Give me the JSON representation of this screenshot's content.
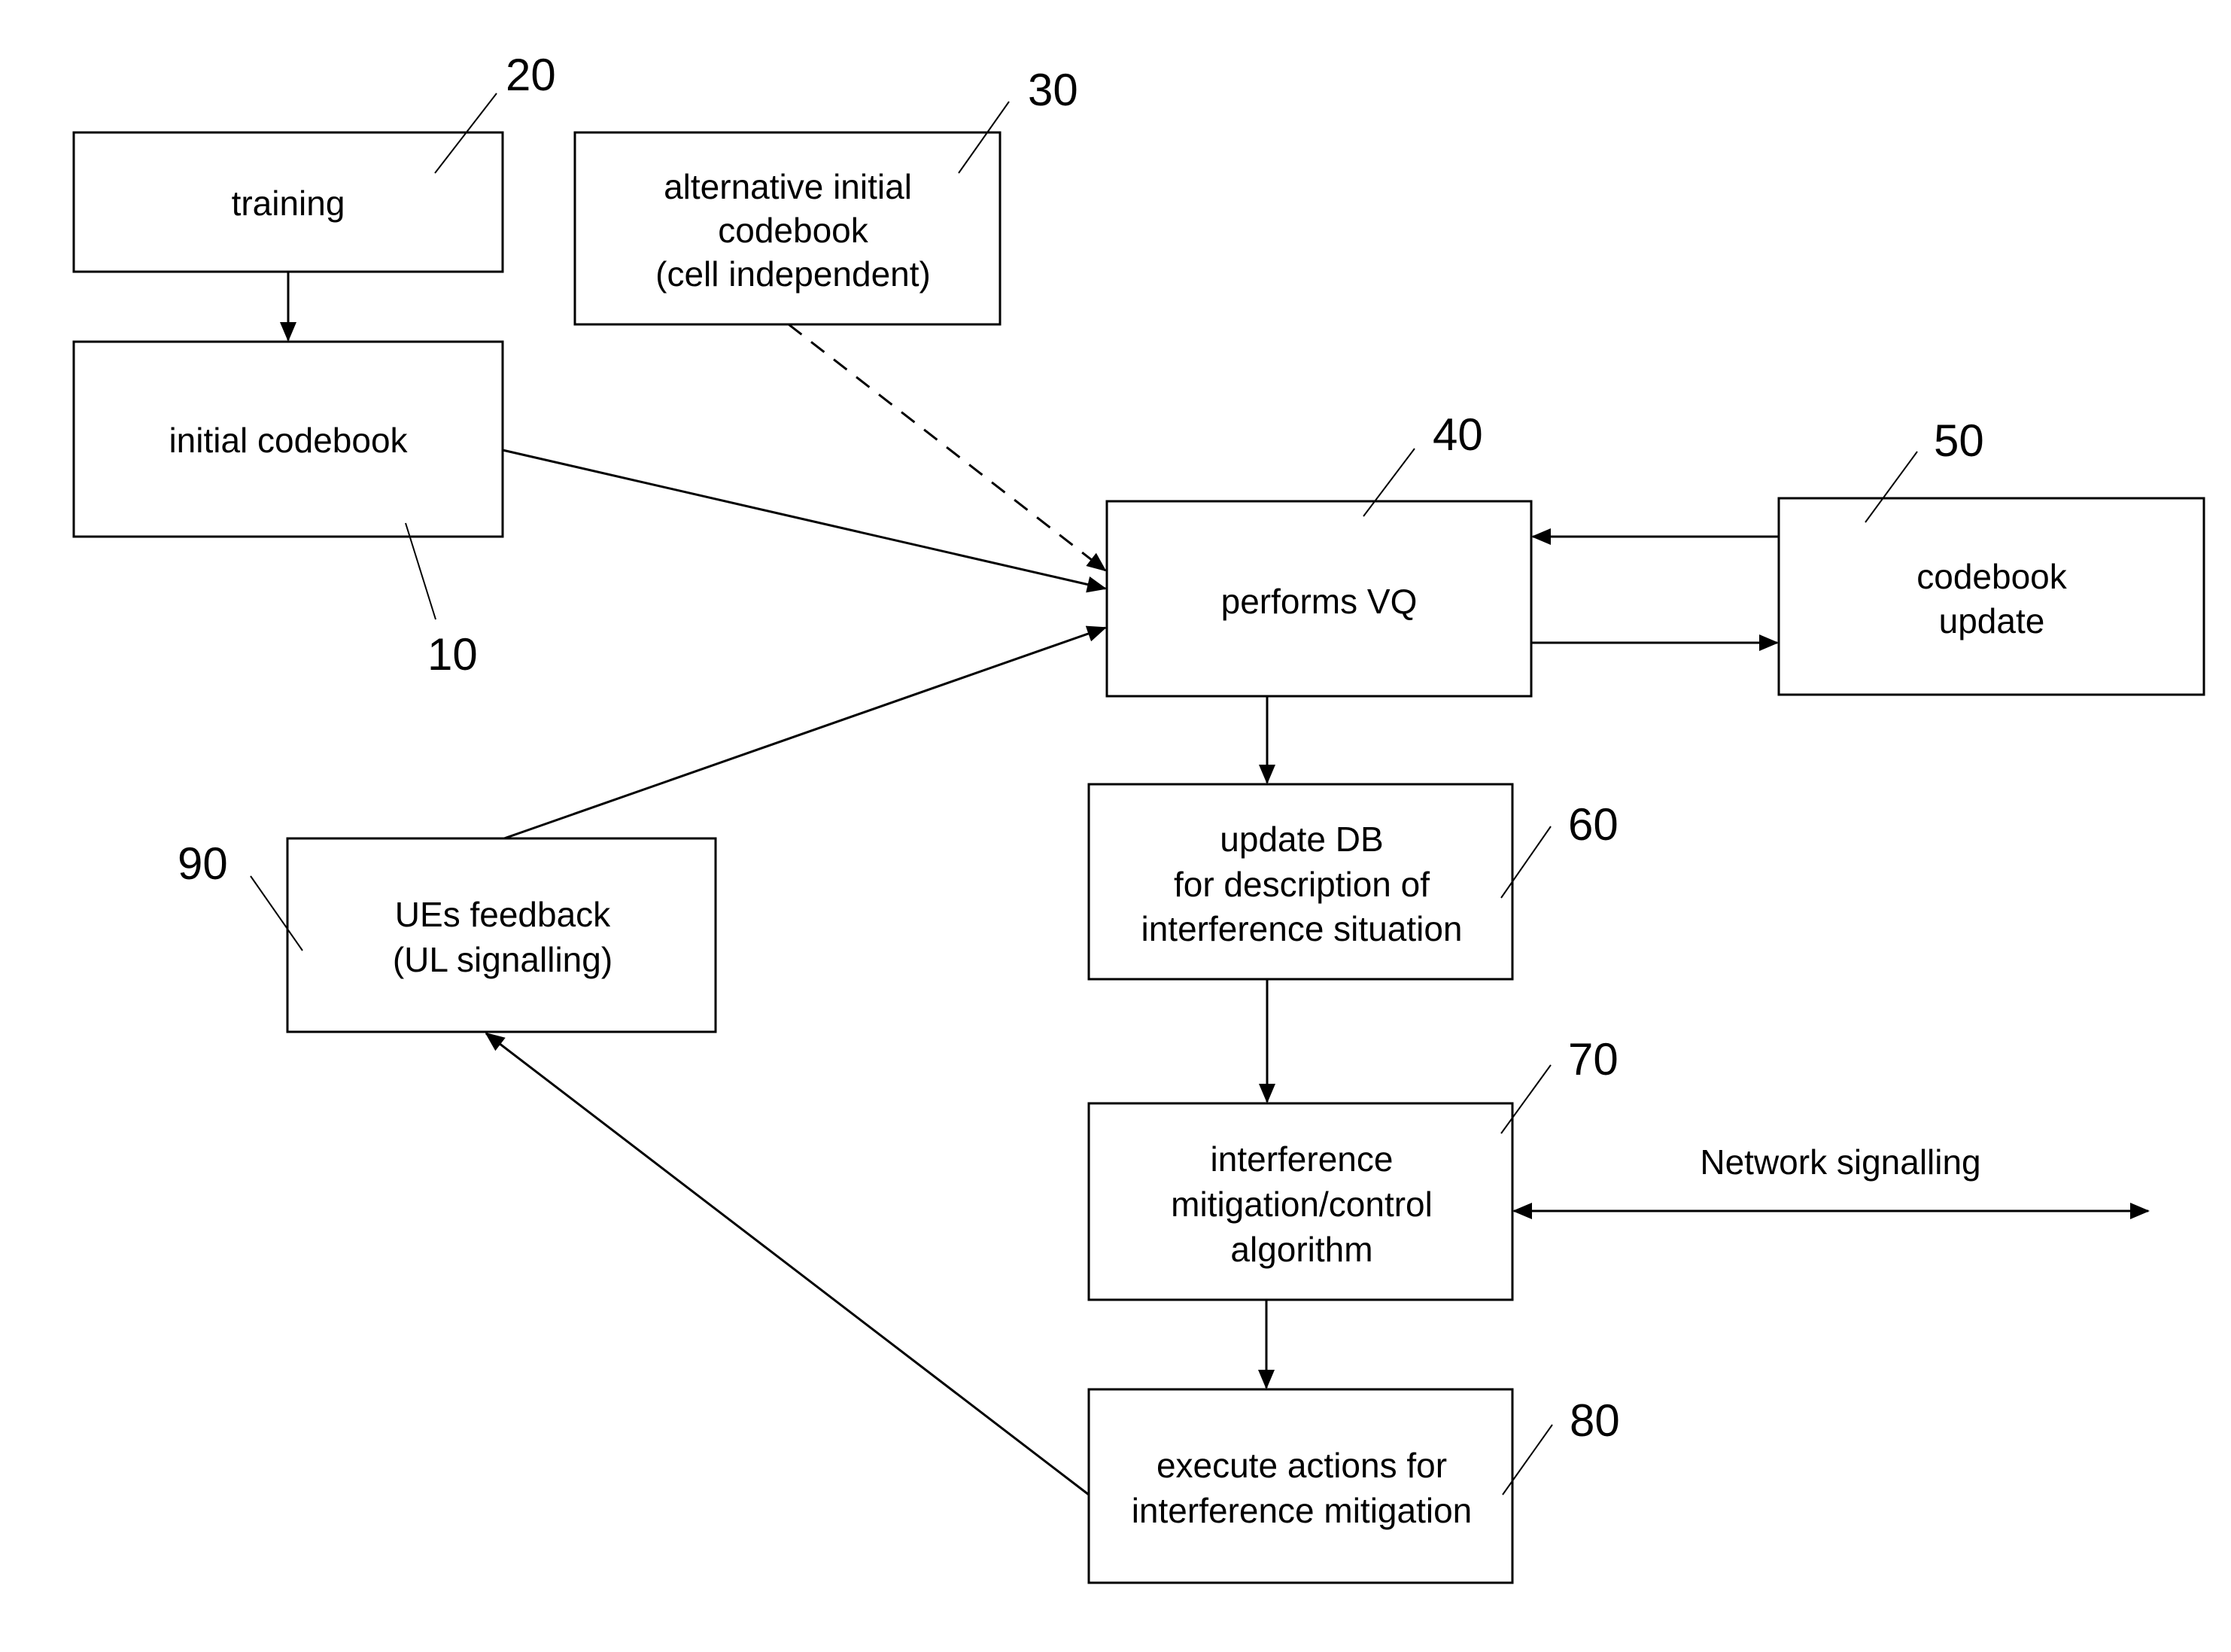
{
  "diagram": {
    "type": "flowchart",
    "colors": {
      "stroke": "#000000",
      "background": "#ffffff"
    },
    "blocks": [
      {
        "id": "training",
        "ref": "20",
        "lines": [
          "training"
        ]
      },
      {
        "id": "initial_codebook",
        "ref": "10",
        "lines": [
          "initial codebook"
        ]
      },
      {
        "id": "alt_initial_codebook",
        "ref": "30",
        "lines": [
          "alternative initial",
          "codebook",
          "(cell independent)"
        ]
      },
      {
        "id": "performs_vq",
        "ref": "40",
        "lines": [
          "performs VQ"
        ]
      },
      {
        "id": "codebook_update",
        "ref": "50",
        "lines": [
          "codebook",
          "update"
        ]
      },
      {
        "id": "update_db",
        "ref": "60",
        "lines": [
          "update DB",
          "for description of",
          "interference situation"
        ]
      },
      {
        "id": "interference_algorithm",
        "ref": "70",
        "lines": [
          "interference",
          "mitigation/control",
          "algorithm"
        ]
      },
      {
        "id": "execute_actions",
        "ref": "80",
        "lines": [
          "execute actions for",
          "interference mitigation"
        ]
      },
      {
        "id": "ues_feedback",
        "ref": "90",
        "lines": [
          "UEs feedback",
          "(UL signalling)"
        ]
      }
    ],
    "edges": [
      {
        "from": "training",
        "to": "initial_codebook",
        "style": "solid"
      },
      {
        "from": "initial_codebook",
        "to": "performs_vq",
        "style": "solid"
      },
      {
        "from": "alt_initial_codebook",
        "to": "performs_vq",
        "style": "dashed"
      },
      {
        "from": "ues_feedback",
        "to": "performs_vq",
        "style": "solid"
      },
      {
        "from": "codebook_update",
        "to": "performs_vq",
        "style": "solid"
      },
      {
        "from": "performs_vq",
        "to": "codebook_update",
        "style": "solid"
      },
      {
        "from": "performs_vq",
        "to": "update_db",
        "style": "solid"
      },
      {
        "from": "update_db",
        "to": "interference_algorithm",
        "style": "solid"
      },
      {
        "from": "interference_algorithm",
        "to": "execute_actions",
        "style": "solid"
      },
      {
        "from": "execute_actions",
        "to": "ues_feedback",
        "style": "solid"
      },
      {
        "from": "interference_algorithm",
        "to": "external",
        "style": "bidirectional",
        "label": "Network signalling"
      }
    ],
    "network_signalling_label": "Network signalling"
  }
}
